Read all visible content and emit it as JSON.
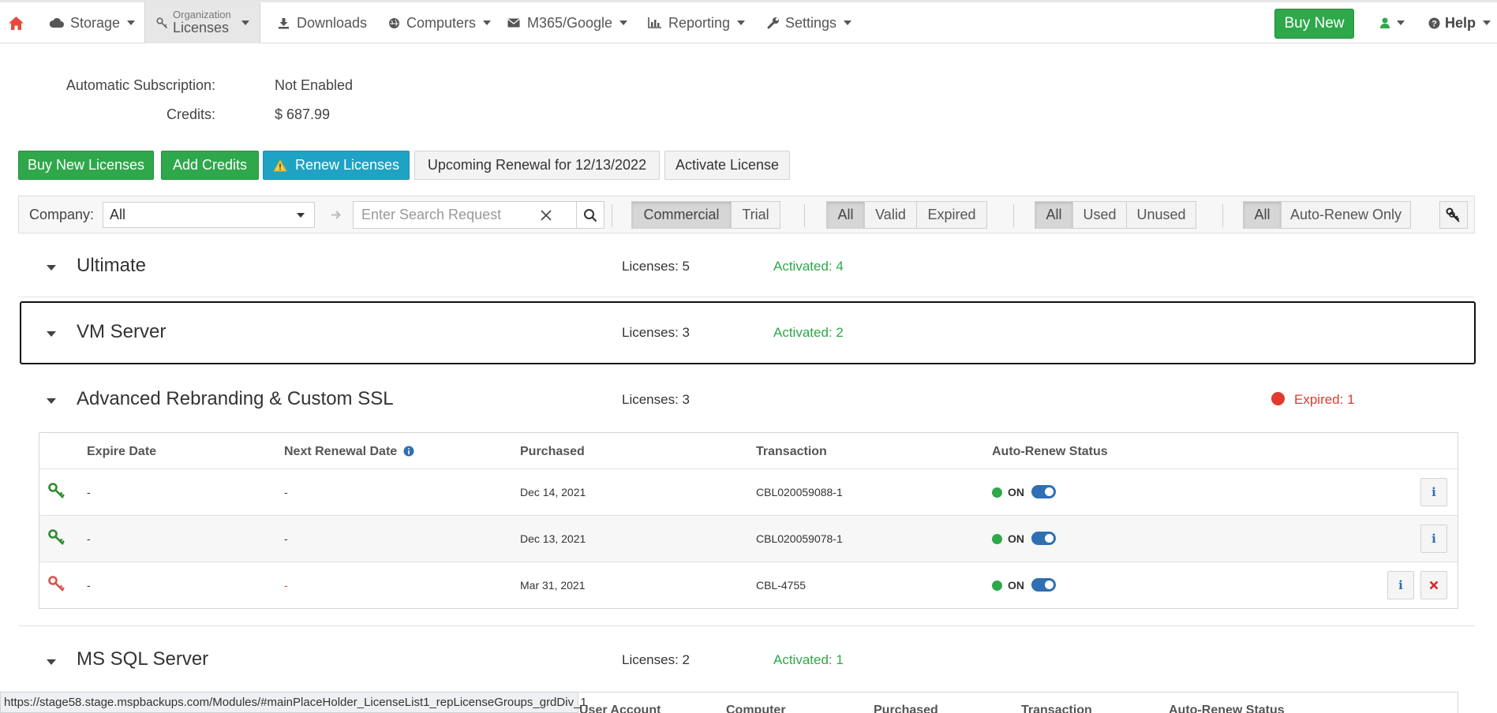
{
  "nav": {
    "storage": "Storage",
    "org_top": "Organization",
    "org_bottom": "Licenses",
    "downloads": "Downloads",
    "computers": "Computers",
    "m365": "M365/Google",
    "reporting": "Reporting",
    "settings": "Settings",
    "buy_new": "Buy New",
    "help": "Help"
  },
  "summary": {
    "auto_sub_label": "Automatic Subscription:",
    "auto_sub_value": "Not Enabled",
    "credits_label": "Credits:",
    "credits_value": "$ 687.99"
  },
  "actions": {
    "buy_new_licenses": "Buy New Licenses",
    "add_credits": "Add Credits",
    "renew_licenses": "Renew Licenses",
    "upcoming_renewal": "Upcoming Renewal for 12/13/2022",
    "activate_license": "Activate License"
  },
  "filters": {
    "company_label": "Company:",
    "company_value": "All",
    "search_placeholder": "Enter Search Request",
    "type": [
      "Commercial",
      "Trial"
    ],
    "validity": [
      "All",
      "Valid",
      "Expired"
    ],
    "usage": [
      "All",
      "Used",
      "Unused"
    ],
    "renew": [
      "All",
      "Auto-Renew Only"
    ]
  },
  "groups": [
    {
      "title": "Ultimate",
      "licenses": "Licenses: 5",
      "activated": "Activated: 4"
    },
    {
      "title": "VM Server",
      "licenses": "Licenses: 3",
      "activated": "Activated: 2"
    },
    {
      "title": "Advanced Rebranding & Custom SSL",
      "licenses": "Licenses: 3",
      "expired": "Expired: 1"
    },
    {
      "title": "MS SQL Server",
      "licenses": "Licenses: 2",
      "activated": "Activated: 1"
    }
  ],
  "table": {
    "headers": [
      "Expire Date",
      "Next Renewal Date",
      "Purchased",
      "Transaction",
      "Auto-Renew Status"
    ],
    "rows": [
      {
        "expire": "-",
        "next": "-",
        "purchased": "Dec 14, 2021",
        "transaction": "CBL020059088-1",
        "status": "ON"
      },
      {
        "expire": "-",
        "next": "-",
        "purchased": "Dec 13, 2021",
        "transaction": "CBL020059078-1",
        "status": "ON"
      },
      {
        "expire": "-",
        "next": "-",
        "purchased": "Mar 31, 2021",
        "transaction": "CBL-4755",
        "status": "ON"
      }
    ]
  },
  "next_table_headers": [
    "User Account",
    "Computer",
    "Purchased",
    "Transaction",
    "Auto-Renew Status"
  ],
  "status_url": "https://stage58.stage.mspbackups.com/Modules/#mainPlaceHolder_LicenseList1_repLicenseGroups_grdDiv_1",
  "colors": {
    "green": "#2ea84a",
    "teal": "#1ea3c4",
    "red": "#e13a2e",
    "home": "#e8483c",
    "toggle": "#2f6fb2"
  }
}
